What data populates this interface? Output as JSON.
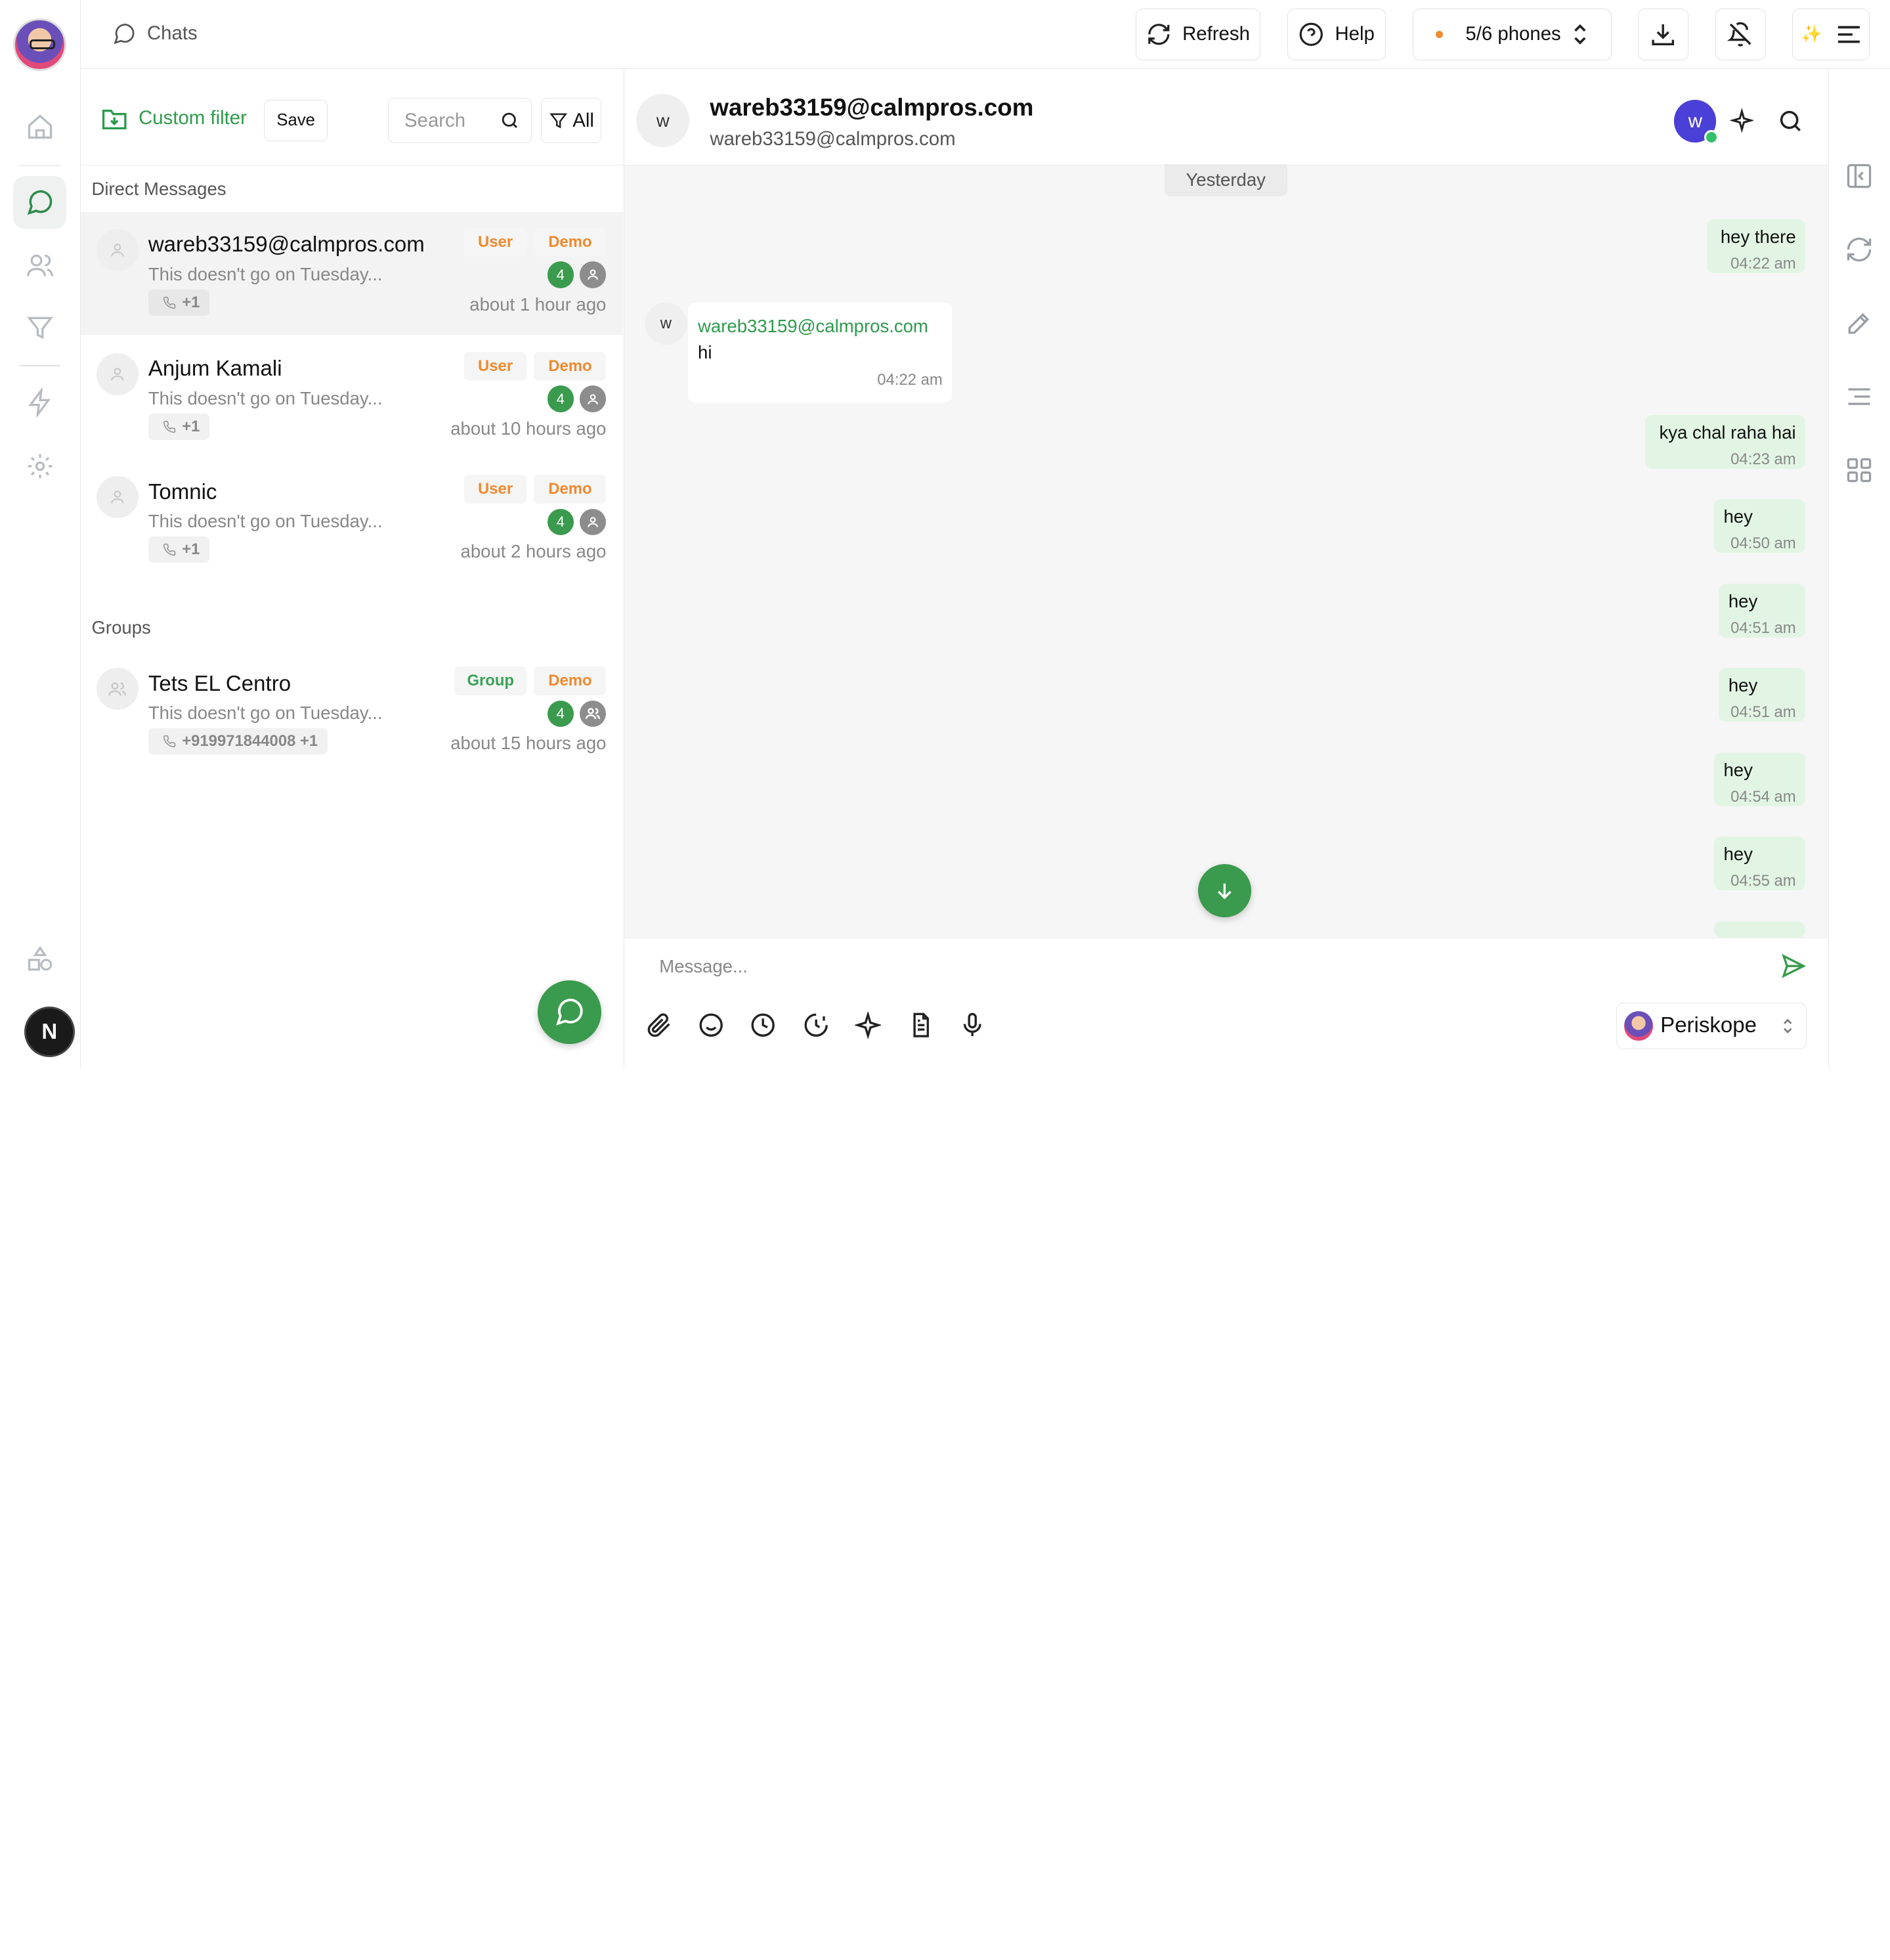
{
  "nav": {
    "user_initial": "N"
  },
  "topbar": {
    "title": "Chats",
    "refresh_label": "Refresh",
    "help_label": "Help",
    "phones_label": "5/6 phones",
    "status_dot_color": "#f08a2f"
  },
  "list": {
    "custom_filter_label": "Custom filter",
    "save_label": "Save",
    "search_placeholder": "Search",
    "filter_all_label": "All",
    "direct_section": "Direct Messages",
    "groups_section": "Groups",
    "chats": [
      {
        "name": "wareb33159@calmpros.com",
        "preview": "This doesn't go on Tuesday...",
        "phone": "+1",
        "tag1": "User",
        "tag2": "Demo",
        "count": "4",
        "time": "about 1 hour ago"
      },
      {
        "name": "Anjum Kamali",
        "preview": "This doesn't go on Tuesday...",
        "phone": "+1",
        "tag1": "User",
        "tag2": "Demo",
        "count": "4",
        "time": "about 10 hours ago"
      },
      {
        "name": "Tomnic",
        "preview": "This doesn't go on Tuesday...",
        "phone": "+1",
        "tag1": "User",
        "tag2": "Demo",
        "count": "4",
        "time": "about 2 hours ago"
      }
    ],
    "groups": [
      {
        "name": "Tets EL Centro",
        "preview": "This doesn't go on Tuesday...",
        "phone": "+919971844008 +1",
        "tag1": "Group",
        "tag2": "Demo",
        "count": "4",
        "time": "about 15 hours ago"
      }
    ]
  },
  "conversation": {
    "avatar_initial": "w",
    "name": "wareb33159@calmpros.com",
    "subtitle": "wareb33159@calmpros.com",
    "header_badge_initial": "w",
    "day_label": "Yesterday",
    "incoming": {
      "avatar_initial": "w",
      "sender": "wareb33159@calmpros.com",
      "text": "hi",
      "time": "04:22 am"
    },
    "outgoing": [
      {
        "text": "hey there",
        "time": "04:22 am"
      },
      {
        "text": "kya chal raha hai",
        "time": "04:23 am"
      },
      {
        "text": "hey",
        "time": "04:50 am"
      },
      {
        "text": "hey",
        "time": "04:51 am"
      },
      {
        "text": "hey",
        "time": "04:51 am"
      },
      {
        "text": "hey",
        "time": "04:54 am"
      },
      {
        "text": "hey",
        "time": "04:55 am"
      }
    ],
    "composer_placeholder": "Message...",
    "sender_account": "Periskope"
  },
  "colors": {
    "accent": "#3a9a4d",
    "outgoing_bubble": "#e2f5e4",
    "tag_orange": "#f08a2f",
    "tag_green": "#3aa357",
    "header_badge": "#4a3fd6"
  }
}
